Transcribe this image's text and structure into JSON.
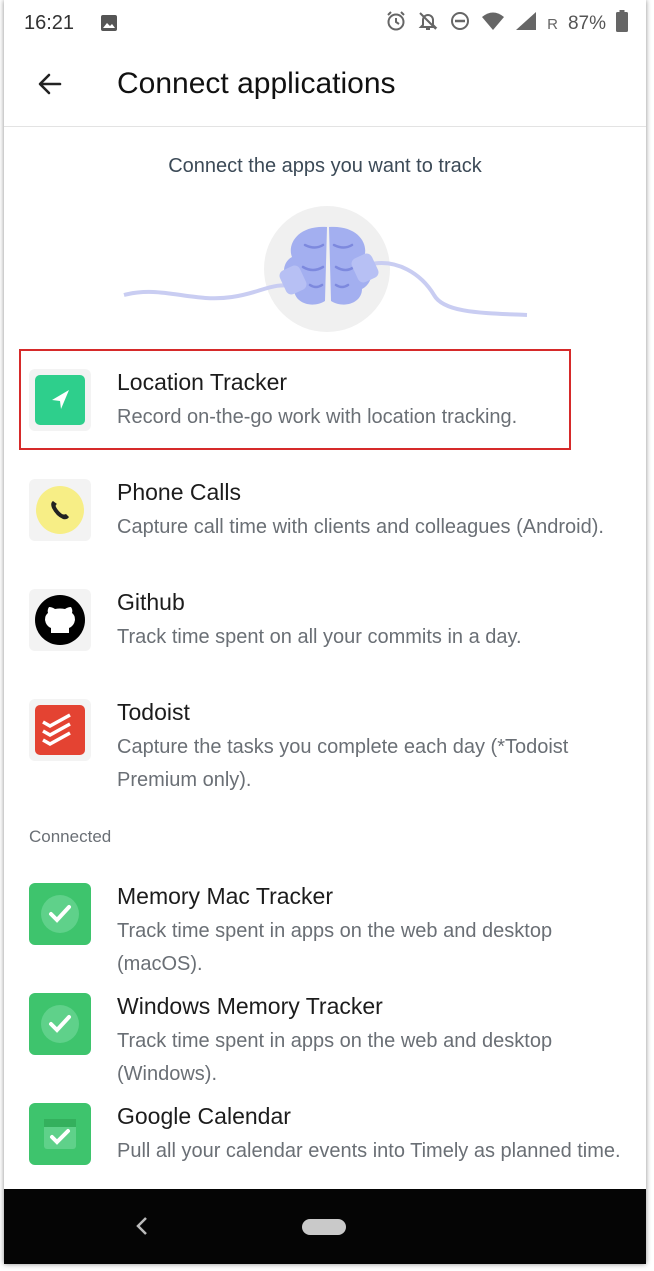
{
  "status_bar": {
    "time": "16:21",
    "carrier_mark": "R",
    "battery": "87%",
    "icons": [
      "image-icon",
      "alarm-icon",
      "notifications-off-icon",
      "do-not-disturb-icon",
      "wifi-icon",
      "signal-icon",
      "battery-icon"
    ]
  },
  "app_bar": {
    "title": "Connect applications",
    "back_icon": "arrow-back-icon"
  },
  "intro": {
    "subtitle": "Connect the apps you want to track",
    "illustration": "brain-with-plugged-cables"
  },
  "available": [
    {
      "name": "Location Tracker",
      "description": "Record on-the-go work with location tracking.",
      "icon": "location-arrow-icon",
      "icon_color": "#2ecf8c",
      "highlighted": true
    },
    {
      "name": "Phone Calls",
      "description": "Capture call time with clients and colleagues (Android).",
      "icon": "phone-icon",
      "icon_color": "#f7ee86"
    },
    {
      "name": "Github",
      "description": "Track time spent on all your commits in a day.",
      "icon": "github-icon",
      "icon_color": "#000000"
    },
    {
      "name": "Todoist",
      "description": "Capture the tasks you complete each day (*Todoist Premium only).",
      "icon": "todoist-icon",
      "icon_color": "#e44332"
    }
  ],
  "connected_label": "Connected",
  "connected": [
    {
      "name": "Memory Mac Tracker",
      "description": "Track time spent in apps on the web and desktop (macOS).",
      "icon": "memory-check-icon",
      "icon_color": "#3ec46d"
    },
    {
      "name": "Windows Memory Tracker",
      "description": "Track time spent in apps on the web and desktop (Windows).",
      "icon": "memory-check-icon",
      "icon_color": "#3ec46d"
    },
    {
      "name": "Google Calendar",
      "description": "Pull all your calendar events into Timely as planned time.",
      "icon": "calendar-check-icon",
      "icon_color": "#3ec46d"
    }
  ],
  "colors": {
    "highlight_border": "#d62a2a",
    "connected_green": "#3ec46d",
    "nav_bar": "#050505"
  }
}
